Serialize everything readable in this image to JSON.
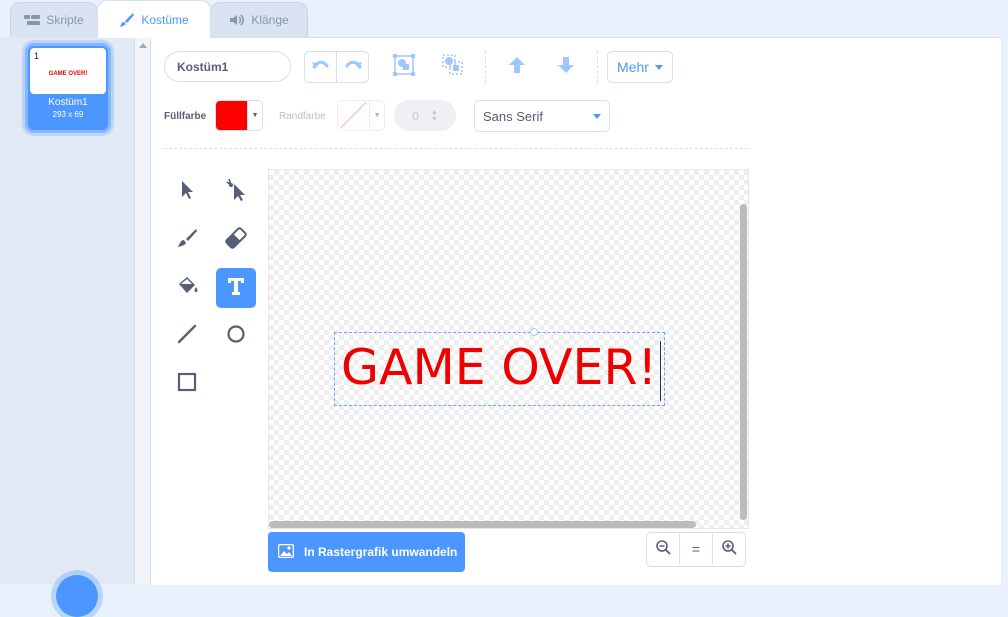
{
  "tabs": {
    "scripts": "Skripte",
    "costumes": "Kostüme",
    "sounds": "Klänge"
  },
  "costume_list": {
    "items": [
      {
        "number": "1",
        "name": "Kostüm1",
        "size": "293 x 69",
        "thumb_text": "GAME OVER!"
      }
    ]
  },
  "editor": {
    "costume_name": "Kostüm1",
    "more_label": "Mehr",
    "fill_label": "Füllfarbe",
    "outline_label": "Randfarbe",
    "stroke_width": "0",
    "font": "Sans Serif",
    "fill_color": "#ff0000",
    "canvas_text": "GAME OVER!",
    "convert_button": "In Rastergrafik umwandeln",
    "zoom_reset": "="
  },
  "colors": {
    "accent": "#4c97ff",
    "text_fill": "#ee0000"
  },
  "icons": [
    "code-icon",
    "brush-icon",
    "speaker-icon",
    "undo-icon",
    "redo-icon",
    "group-icon",
    "ungroup-icon",
    "forward-icon",
    "backward-icon",
    "select-icon",
    "reshape-icon",
    "brush-tool-icon",
    "eraser-icon",
    "fill-icon",
    "text-icon",
    "line-icon",
    "circle-icon",
    "rectangle-icon",
    "image-icon",
    "zoom-out-icon",
    "zoom-in-icon"
  ]
}
